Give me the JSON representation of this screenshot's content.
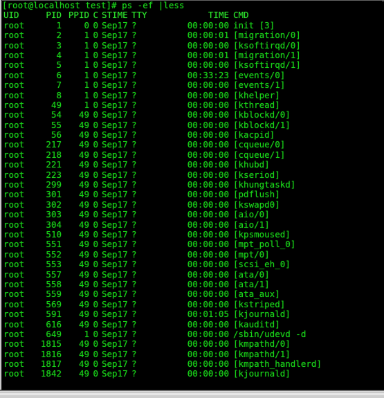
{
  "terminal": {
    "prompt_line": "[root@localhost test]# ps -ef |less",
    "columns": {
      "uid": "UID",
      "pid": "PID",
      "ppid": "PPID",
      "c": "C",
      "stime": "STIME",
      "tty": "TTY",
      "time": "TIME",
      "cmd": "CMD"
    },
    "colors": {
      "foreground": "#19d219",
      "background": "#000000",
      "chrome": "#cfcfcf"
    },
    "rows": [
      {
        "uid": "root",
        "pid": "1",
        "ppid": "0",
        "c": "0",
        "stime": "Sep17",
        "tty": "?",
        "time": "00:00:00",
        "cmd": "init [3]"
      },
      {
        "uid": "root",
        "pid": "2",
        "ppid": "1",
        "c": "0",
        "stime": "Sep17",
        "tty": "?",
        "time": "00:00:01",
        "cmd": "[migration/0]"
      },
      {
        "uid": "root",
        "pid": "3",
        "ppid": "1",
        "c": "0",
        "stime": "Sep17",
        "tty": "?",
        "time": "00:00:00",
        "cmd": "[ksoftirqd/0]"
      },
      {
        "uid": "root",
        "pid": "4",
        "ppid": "1",
        "c": "0",
        "stime": "Sep17",
        "tty": "?",
        "time": "00:00:01",
        "cmd": "[migration/1]"
      },
      {
        "uid": "root",
        "pid": "5",
        "ppid": "1",
        "c": "0",
        "stime": "Sep17",
        "tty": "?",
        "time": "00:00:00",
        "cmd": "[ksoftirqd/1]"
      },
      {
        "uid": "root",
        "pid": "6",
        "ppid": "1",
        "c": "0",
        "stime": "Sep17",
        "tty": "?",
        "time": "00:33:23",
        "cmd": "[events/0]"
      },
      {
        "uid": "root",
        "pid": "7",
        "ppid": "1",
        "c": "0",
        "stime": "Sep17",
        "tty": "?",
        "time": "00:00:00",
        "cmd": "[events/1]"
      },
      {
        "uid": "root",
        "pid": "8",
        "ppid": "1",
        "c": "0",
        "stime": "Sep17",
        "tty": "?",
        "time": "00:00:00",
        "cmd": "[khelper]"
      },
      {
        "uid": "root",
        "pid": "49",
        "ppid": "1",
        "c": "0",
        "stime": "Sep17",
        "tty": "?",
        "time": "00:00:00",
        "cmd": "[kthread]"
      },
      {
        "uid": "root",
        "pid": "54",
        "ppid": "49",
        "c": "0",
        "stime": "Sep17",
        "tty": "?",
        "time": "00:00:00",
        "cmd": "[kblockd/0]"
      },
      {
        "uid": "root",
        "pid": "55",
        "ppid": "49",
        "c": "0",
        "stime": "Sep17",
        "tty": "?",
        "time": "00:00:00",
        "cmd": "[kblockd/1]"
      },
      {
        "uid": "root",
        "pid": "56",
        "ppid": "49",
        "c": "0",
        "stime": "Sep17",
        "tty": "?",
        "time": "00:00:00",
        "cmd": "[kacpid]"
      },
      {
        "uid": "root",
        "pid": "217",
        "ppid": "49",
        "c": "0",
        "stime": "Sep17",
        "tty": "?",
        "time": "00:00:00",
        "cmd": "[cqueue/0]"
      },
      {
        "uid": "root",
        "pid": "218",
        "ppid": "49",
        "c": "0",
        "stime": "Sep17",
        "tty": "?",
        "time": "00:00:00",
        "cmd": "[cqueue/1]"
      },
      {
        "uid": "root",
        "pid": "221",
        "ppid": "49",
        "c": "0",
        "stime": "Sep17",
        "tty": "?",
        "time": "00:00:00",
        "cmd": "[khubd]"
      },
      {
        "uid": "root",
        "pid": "223",
        "ppid": "49",
        "c": "0",
        "stime": "Sep17",
        "tty": "?",
        "time": "00:00:00",
        "cmd": "[kseriod]"
      },
      {
        "uid": "root",
        "pid": "299",
        "ppid": "49",
        "c": "0",
        "stime": "Sep17",
        "tty": "?",
        "time": "00:00:00",
        "cmd": "[khungtaskd]"
      },
      {
        "uid": "root",
        "pid": "301",
        "ppid": "49",
        "c": "0",
        "stime": "Sep17",
        "tty": "?",
        "time": "00:00:00",
        "cmd": "[pdflush]"
      },
      {
        "uid": "root",
        "pid": "302",
        "ppid": "49",
        "c": "0",
        "stime": "Sep17",
        "tty": "?",
        "time": "00:00:00",
        "cmd": "[kswapd0]"
      },
      {
        "uid": "root",
        "pid": "303",
        "ppid": "49",
        "c": "0",
        "stime": "Sep17",
        "tty": "?",
        "time": "00:00:00",
        "cmd": "[aio/0]"
      },
      {
        "uid": "root",
        "pid": "304",
        "ppid": "49",
        "c": "0",
        "stime": "Sep17",
        "tty": "?",
        "time": "00:00:00",
        "cmd": "[aio/1]"
      },
      {
        "uid": "root",
        "pid": "510",
        "ppid": "49",
        "c": "0",
        "stime": "Sep17",
        "tty": "?",
        "time": "00:00:00",
        "cmd": "[kpsmoused]"
      },
      {
        "uid": "root",
        "pid": "551",
        "ppid": "49",
        "c": "0",
        "stime": "Sep17",
        "tty": "?",
        "time": "00:00:00",
        "cmd": "[mpt_poll_0]"
      },
      {
        "uid": "root",
        "pid": "552",
        "ppid": "49",
        "c": "0",
        "stime": "Sep17",
        "tty": "?",
        "time": "00:00:00",
        "cmd": "[mpt/0]"
      },
      {
        "uid": "root",
        "pid": "553",
        "ppid": "49",
        "c": "0",
        "stime": "Sep17",
        "tty": "?",
        "time": "00:00:00",
        "cmd": "[scsi_eh_0]"
      },
      {
        "uid": "root",
        "pid": "557",
        "ppid": "49",
        "c": "0",
        "stime": "Sep17",
        "tty": "?",
        "time": "00:00:00",
        "cmd": "[ata/0]"
      },
      {
        "uid": "root",
        "pid": "558",
        "ppid": "49",
        "c": "0",
        "stime": "Sep17",
        "tty": "?",
        "time": "00:00:00",
        "cmd": "[ata/1]"
      },
      {
        "uid": "root",
        "pid": "559",
        "ppid": "49",
        "c": "0",
        "stime": "Sep17",
        "tty": "?",
        "time": "00:00:00",
        "cmd": "[ata_aux]"
      },
      {
        "uid": "root",
        "pid": "569",
        "ppid": "49",
        "c": "0",
        "stime": "Sep17",
        "tty": "?",
        "time": "00:00:00",
        "cmd": "[kstriped]"
      },
      {
        "uid": "root",
        "pid": "591",
        "ppid": "49",
        "c": "0",
        "stime": "Sep17",
        "tty": "?",
        "time": "00:01:05",
        "cmd": "[kjournald]"
      },
      {
        "uid": "root",
        "pid": "616",
        "ppid": "49",
        "c": "0",
        "stime": "Sep17",
        "tty": "?",
        "time": "00:00:00",
        "cmd": "[kauditd]"
      },
      {
        "uid": "root",
        "pid": "649",
        "ppid": "1",
        "c": "0",
        "stime": "Sep17",
        "tty": "?",
        "time": "00:00:00",
        "cmd": "/sbin/udevd -d"
      },
      {
        "uid": "root",
        "pid": "1815",
        "ppid": "49",
        "c": "0",
        "stime": "Sep17",
        "tty": "?",
        "time": "00:00:00",
        "cmd": "[kmpathd/0]"
      },
      {
        "uid": "root",
        "pid": "1816",
        "ppid": "49",
        "c": "0",
        "stime": "Sep17",
        "tty": "?",
        "time": "00:00:00",
        "cmd": "[kmpathd/1]"
      },
      {
        "uid": "root",
        "pid": "1817",
        "ppid": "49",
        "c": "0",
        "stime": "Sep17",
        "tty": "?",
        "time": "00:00:00",
        "cmd": "[kmpath_handlerd]"
      },
      {
        "uid": "root",
        "pid": "1842",
        "ppid": "49",
        "c": "0",
        "stime": "Sep17",
        "tty": "?",
        "time": "00:00:00",
        "cmd": "[kjournald]"
      }
    ]
  }
}
